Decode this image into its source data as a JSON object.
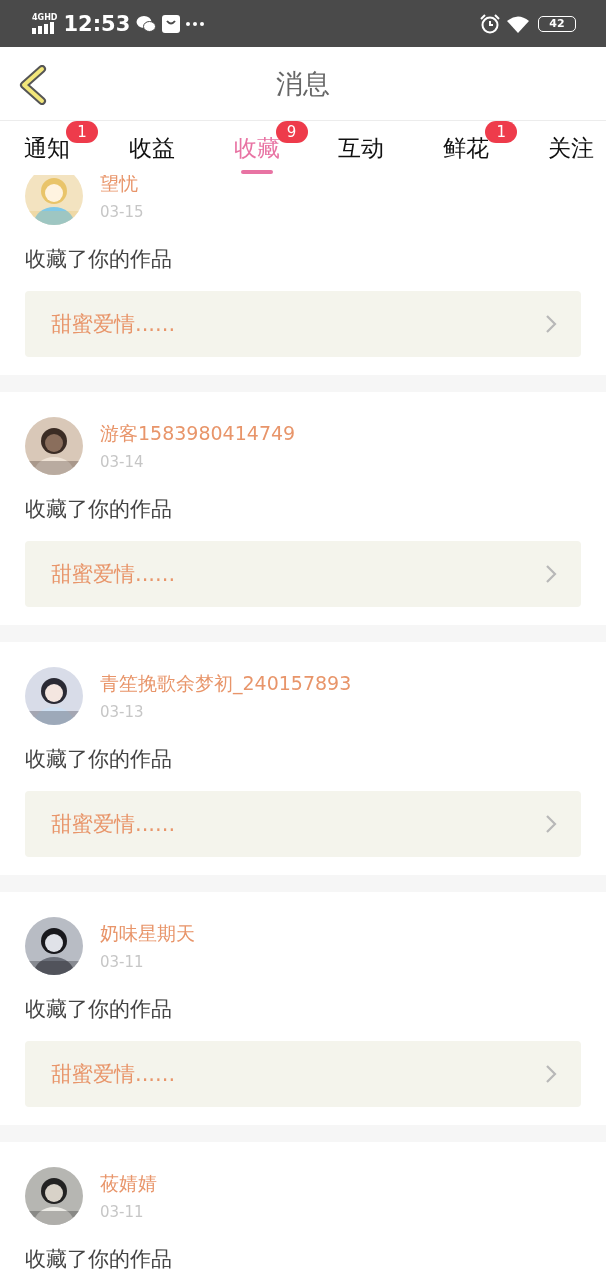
{
  "status_bar": {
    "network": "4GHD",
    "time": "12:53",
    "battery": "42"
  },
  "header": {
    "title": "消息"
  },
  "tabs": [
    {
      "label": "通知",
      "selected": false,
      "badge": "1"
    },
    {
      "label": "收益",
      "selected": false
    },
    {
      "label": "收藏",
      "selected": true,
      "badge": "9"
    },
    {
      "label": "互动",
      "selected": false
    },
    {
      "label": "鲜花",
      "selected": false,
      "badge": "1"
    },
    {
      "label": "关注",
      "selected": false
    }
  ],
  "messages": [
    {
      "user": "望忧",
      "date": "03-15",
      "text": "收藏了你的作品",
      "work": "甜蜜爱情......"
    },
    {
      "user": "游客1583980414749",
      "date": "03-14",
      "text": "收藏了你的作品",
      "work": "甜蜜爱情......"
    },
    {
      "user": "青笙挽歌余梦初_240157893",
      "date": "03-13",
      "text": "收藏了你的作品",
      "work": "甜蜜爱情......"
    },
    {
      "user": "奶味星期天",
      "date": "03-11",
      "text": "收藏了你的作品",
      "work": "甜蜜爱情......"
    },
    {
      "user": "莜婧婧",
      "date": "03-11",
      "text": "收藏了你的作品"
    }
  ]
}
